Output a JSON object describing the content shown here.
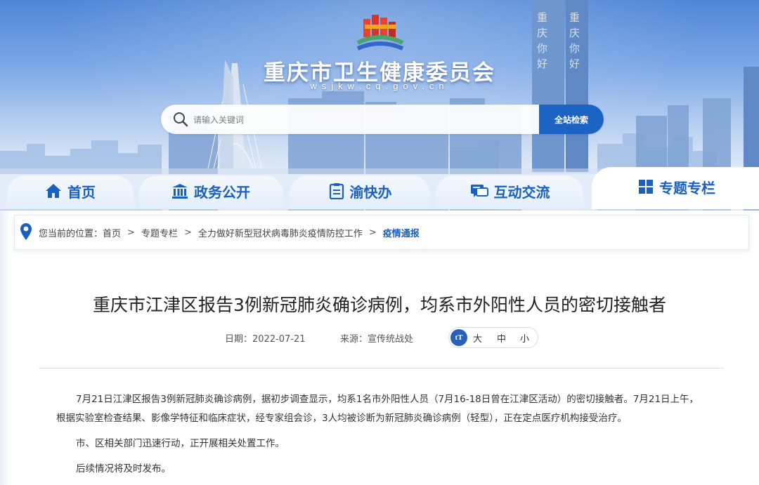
{
  "header": {
    "site_title": "重庆市卫生健康委员会",
    "site_domain": "wsjkw.cq.gov.cn",
    "search": {
      "placeholder": "请输入关键词",
      "button_label": "全站检索"
    }
  },
  "nav": {
    "tabs": [
      {
        "label": "首页",
        "icon": "home-icon"
      },
      {
        "label": "政务公开",
        "icon": "government-building-icon"
      },
      {
        "label": "渝快办",
        "icon": "clipboard-icon"
      },
      {
        "label": "互动交流",
        "icon": "chat-bubble-icon"
      },
      {
        "label": "专题专栏",
        "icon": "grid-icon",
        "active": true
      }
    ]
  },
  "breadcrumb": {
    "prefix": "您当前的位置：",
    "items": [
      "首页",
      "专题专栏",
      "全力做好新型冠状病毒肺炎疫情防控工作",
      "疫情通报"
    ],
    "separator": ">"
  },
  "article": {
    "title": "重庆市江津区报告3例新冠肺炎确诊病例，均系市外阳性人员的密切接触者",
    "date": "日期：2022-07-21",
    "source": "来源：宣传统战处",
    "font_size": {
      "icon_label": "tT",
      "large": "大",
      "medium": "中",
      "small": "小"
    },
    "paragraphs": [
      "7月21日江津区报告3例新冠肺炎确诊病例，据初步调查显示，均系1名市外阳性人员（7月16-18日曾在江津区活动）的密切接触者。7月21日上午，根据实验室检查结果、影像学特征和临床症状，经专家组会诊，3人均被诊断为新冠肺炎确诊病例（轻型），正在定点医疗机构接受治疗。",
      "市、区相关部门迅速行动，正开展相关处置工作。",
      "后续情况将及时发布。"
    ]
  },
  "colors": {
    "brand_blue": "#1b5fbf",
    "button_blue": "#1d63c4",
    "nav_bg": "#e2edf9"
  }
}
